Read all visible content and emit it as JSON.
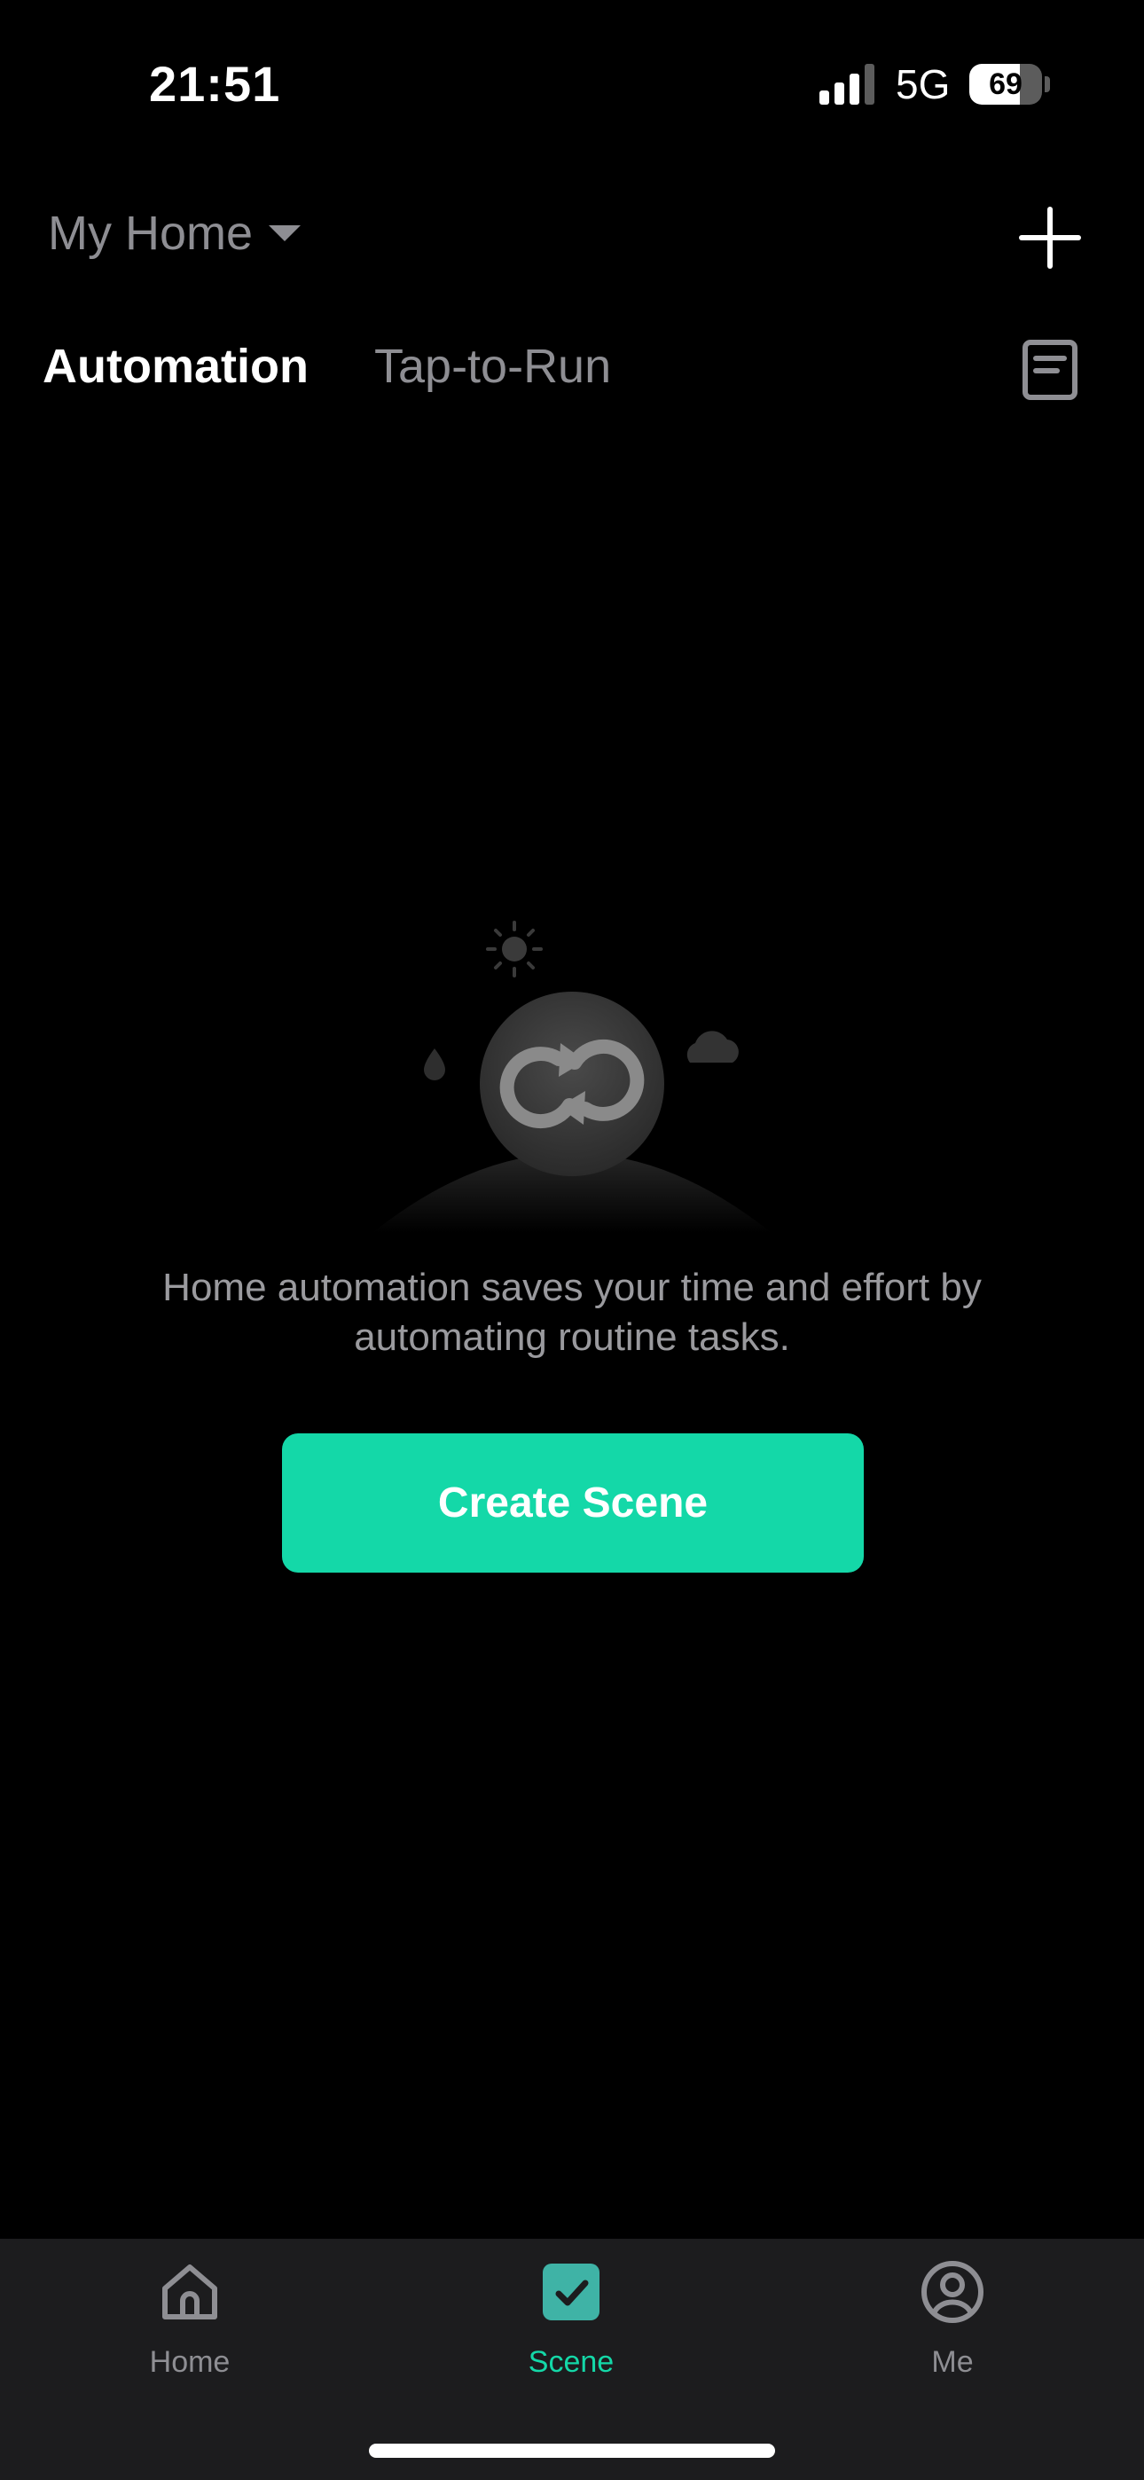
{
  "status_bar": {
    "time": "21:51",
    "network": "5G",
    "battery_level": "69",
    "battery_fraction": 0.69
  },
  "header": {
    "home_name": "My Home",
    "add_icon": "plus-icon"
  },
  "tabs": [
    {
      "label": "Automation",
      "active": true
    },
    {
      "label": "Tap-to-Run",
      "active": false
    }
  ],
  "log_icon": "document-icon",
  "empty_state": {
    "message": "Home automation saves your time and effort by automating routine tasks.",
    "button_label": "Create Scene",
    "illustration_icons": [
      "sun-icon",
      "water-drop-icon",
      "cloud-icon",
      "sync-icon"
    ]
  },
  "bottom_nav": {
    "items": [
      {
        "label": "Home",
        "icon": "home-icon",
        "active": false
      },
      {
        "label": "Scene",
        "icon": "scene-check-icon",
        "active": true
      },
      {
        "label": "Me",
        "icon": "profile-icon",
        "active": false
      }
    ]
  },
  "colors": {
    "accent": "#14d8a8",
    "background": "#000000",
    "nav_background": "#1c1c1e",
    "inactive_text": "#8e8e93"
  }
}
